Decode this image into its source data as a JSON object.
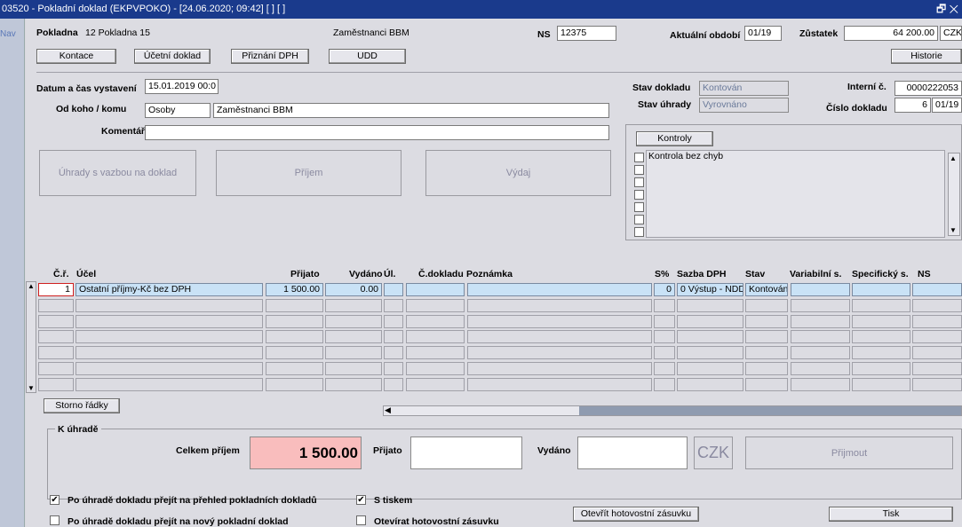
{
  "window": {
    "title": "03520 - Pokladní doklad (EKPVPOKO) - [24.06.2020; 09:42] [ ] [ ]",
    "nav_label": "Nav",
    "controls_glyphs": "🗗 ✕"
  },
  "header": {
    "pokladna_label": "Pokladna",
    "pokladna_value": "12 Pokladna 15",
    "center_text": "Zaměstnanci BBM",
    "ns_label": "NS",
    "ns_value": "12375",
    "period_label": "Aktuální období",
    "period_value": "01/19",
    "balance_label": "Zůstatek",
    "balance_value": "64 200.00",
    "currency": "CZK"
  },
  "toolbar": {
    "kontace": "Kontace",
    "ucetni_doklad": "Účetní doklad",
    "priznani_dph": "Přiznání DPH",
    "udd": "UDD",
    "historie": "Historie"
  },
  "form": {
    "datetime_label": "Datum a čas vystavení",
    "datetime_value": "15.01.2019 00:0",
    "from_to_label": "Od koho / komu",
    "from_to_type": "Osoby",
    "from_to_name": "Zaměstnanci BBM",
    "comment_label": "Komentář",
    "comment_value": "",
    "stav_dokladu_label": "Stav dokladu",
    "stav_dokladu_value": "Kontován",
    "stav_uhrady_label": "Stav úhrady",
    "stav_uhrady_value": "Vyrovnáno",
    "interni_label": "Interní č.",
    "interni_value": "0000222053",
    "cislo_label": "Číslo dokladu",
    "cislo_value": "6",
    "cislo_period": "01/19"
  },
  "actions": {
    "uhrady": "Úhrady s vazbou na doklad",
    "prijem": "Příjem",
    "vydaj": "Výdaj"
  },
  "kontroly": {
    "button": "Kontroly",
    "items": [
      "Kontrola bez chyb",
      "",
      "",
      "",
      "",
      "",
      ""
    ]
  },
  "table": {
    "headers": {
      "cr": "Č.ř.",
      "ucel": "Účel",
      "prijato": "Přijato",
      "vydano": "Vydáno",
      "ul": "Úl.",
      "cdokladu": "Č.dokladu",
      "poznamka": "Poznámka",
      "sp": "S%",
      "sazba": "Sazba DPH",
      "stav": "Stav",
      "vs": "Variabilní s.",
      "ss": "Specifický s.",
      "ns": "NS"
    },
    "rows": [
      {
        "cr": "1",
        "ucel": "Ostatní příjmy-Kč bez DPH",
        "prijato": "1 500.00",
        "vydano": "0.00",
        "ul": "",
        "cdokladu": "",
        "poznamka": "",
        "sp": "0",
        "sazba": "0 Výstup  - NDD",
        "stav": "Kontován",
        "vs": "",
        "ss": "",
        "ns": ""
      },
      {
        "cr": "",
        "ucel": "",
        "prijato": "",
        "vydano": "",
        "ul": "",
        "cdokladu": "",
        "poznamka": "",
        "sp": "",
        "sazba": "",
        "stav": "",
        "vs": "",
        "ss": "",
        "ns": ""
      },
      {
        "cr": "",
        "ucel": "",
        "prijato": "",
        "vydano": "",
        "ul": "",
        "cdokladu": "",
        "poznamka": "",
        "sp": "",
        "sazba": "",
        "stav": "",
        "vs": "",
        "ss": "",
        "ns": ""
      },
      {
        "cr": "",
        "ucel": "",
        "prijato": "",
        "vydano": "",
        "ul": "",
        "cdokladu": "",
        "poznamka": "",
        "sp": "",
        "sazba": "",
        "stav": "",
        "vs": "",
        "ss": "",
        "ns": ""
      },
      {
        "cr": "",
        "ucel": "",
        "prijato": "",
        "vydano": "",
        "ul": "",
        "cdokladu": "",
        "poznamka": "",
        "sp": "",
        "sazba": "",
        "stav": "",
        "vs": "",
        "ss": "",
        "ns": ""
      },
      {
        "cr": "",
        "ucel": "",
        "prijato": "",
        "vydano": "",
        "ul": "",
        "cdokladu": "",
        "poznamka": "",
        "sp": "",
        "sazba": "",
        "stav": "",
        "vs": "",
        "ss": "",
        "ns": ""
      },
      {
        "cr": "",
        "ucel": "",
        "prijato": "",
        "vydano": "",
        "ul": "",
        "cdokladu": "",
        "poznamka": "",
        "sp": "",
        "sazba": "",
        "stav": "",
        "vs": "",
        "ss": "",
        "ns": ""
      }
    ],
    "storno": "Storno řádky"
  },
  "payment": {
    "group_label": "K úhradě",
    "total_label": "Celkem příjem",
    "total_value": "1 500.00",
    "prijato_label": "Přijato",
    "prijato_value": "",
    "vydano_label": "Vydáno",
    "vydano_value": "",
    "currency": "CZK",
    "prijmout": "Přijmout"
  },
  "options": {
    "opt1": {
      "label": "Po úhradě dokladu přejít na přehled pokladních dokladů",
      "checked": true
    },
    "opt2": {
      "label": "Po úhradě dokladu přejít na nový pokladní doklad",
      "checked": false
    },
    "opt3": {
      "label": "S tiskem",
      "checked": true
    },
    "opt4": {
      "label": "Otevírat hotovostní zásuvku",
      "checked": false
    },
    "open_drawer": "Otevřít hotovostní zásuvku",
    "print": "Tisk"
  },
  "colors": {
    "titlebar": "#1a3a8c",
    "selected_row": "#c9e2f6",
    "total_bg": "#f9bdbd"
  }
}
